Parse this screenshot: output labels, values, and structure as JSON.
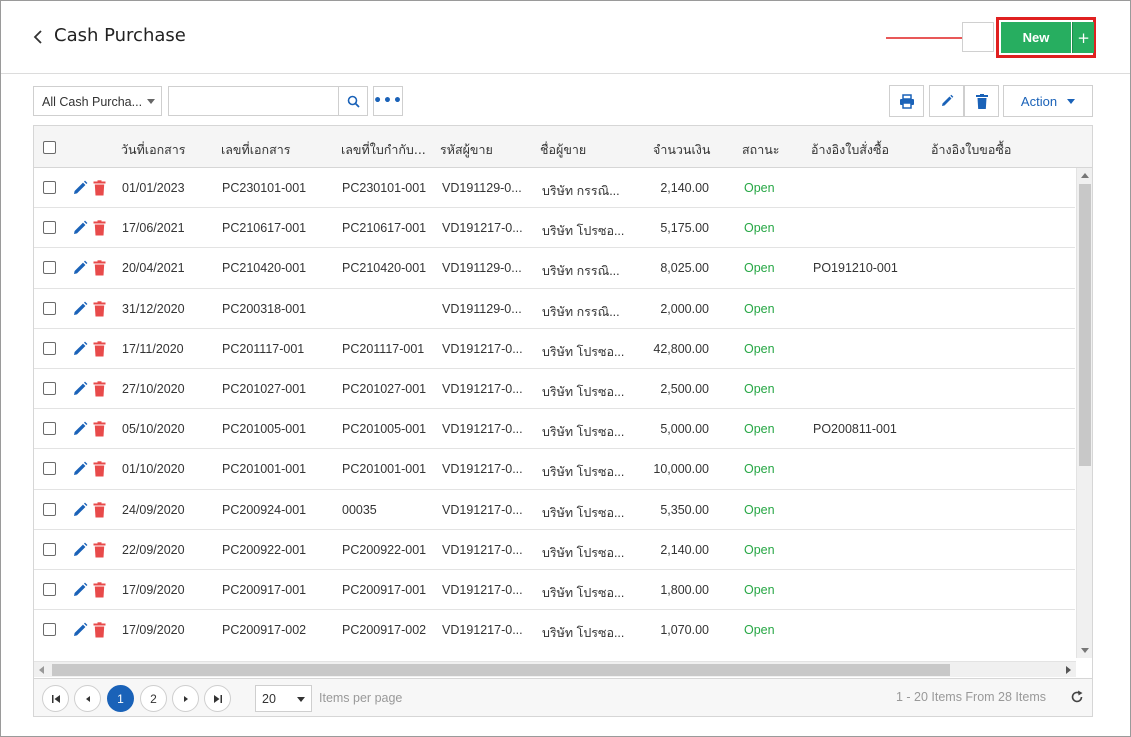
{
  "header": {
    "title": "Cash Purchase",
    "new_label": "New",
    "plus_label": "+"
  },
  "toolbar": {
    "filter_value": "All Cash Purcha...",
    "search_value": "",
    "more_label": "•••",
    "action_label": "Action"
  },
  "table": {
    "columns": [
      "วันที่เอกสาร",
      "เลขที่เอกสาร",
      "เลขที่ใบกำกับ...",
      "รหัสผู้ขาย",
      "ชื่อผู้ขาย",
      "จำนวนเงิน",
      "สถานะ",
      "อ้างอิงใบสั่งซื้อ",
      "อ้างอิงใบขอซื้อ"
    ],
    "rows": [
      {
        "date": "01/01/2023",
        "doc_no": "PC230101-001",
        "tax_inv": "PC230101-001",
        "vendor_code": "VD191129-0...",
        "vendor_name": "บริษัท กรรณิ...",
        "amount": "2,140.00",
        "status": "Open",
        "po_ref": "",
        "pr_ref": ""
      },
      {
        "date": "17/06/2021",
        "doc_no": "PC210617-001",
        "tax_inv": "PC210617-001",
        "vendor_code": "VD191217-0...",
        "vendor_name": "บริษัท โปรซอ...",
        "amount": "5,175.00",
        "status": "Open",
        "po_ref": "",
        "pr_ref": ""
      },
      {
        "date": "20/04/2021",
        "doc_no": "PC210420-001",
        "tax_inv": "PC210420-001",
        "vendor_code": "VD191129-0...",
        "vendor_name": "บริษัท กรรณิ...",
        "amount": "8,025.00",
        "status": "Open",
        "po_ref": "PO191210-001",
        "pr_ref": ""
      },
      {
        "date": "31/12/2020",
        "doc_no": "PC200318-001",
        "tax_inv": "",
        "vendor_code": "VD191129-0...",
        "vendor_name": "บริษัท กรรณิ...",
        "amount": "2,000.00",
        "status": "Open",
        "po_ref": "",
        "pr_ref": ""
      },
      {
        "date": "17/11/2020",
        "doc_no": "PC201117-001",
        "tax_inv": "PC201117-001",
        "vendor_code": "VD191217-0...",
        "vendor_name": "บริษัท โปรซอ...",
        "amount": "42,800.00",
        "status": "Open",
        "po_ref": "",
        "pr_ref": ""
      },
      {
        "date": "27/10/2020",
        "doc_no": "PC201027-001",
        "tax_inv": "PC201027-001",
        "vendor_code": "VD191217-0...",
        "vendor_name": "บริษัท โปรซอ...",
        "amount": "2,500.00",
        "status": "Open",
        "po_ref": "",
        "pr_ref": ""
      },
      {
        "date": "05/10/2020",
        "doc_no": "PC201005-001",
        "tax_inv": "PC201005-001",
        "vendor_code": "VD191217-0...",
        "vendor_name": "บริษัท โปรซอ...",
        "amount": "5,000.00",
        "status": "Open",
        "po_ref": "PO200811-001",
        "pr_ref": ""
      },
      {
        "date": "01/10/2020",
        "doc_no": "PC201001-001",
        "tax_inv": "PC201001-001",
        "vendor_code": "VD191217-0...",
        "vendor_name": "บริษัท โปรซอ...",
        "amount": "10,000.00",
        "status": "Open",
        "po_ref": "",
        "pr_ref": ""
      },
      {
        "date": "24/09/2020",
        "doc_no": "PC200924-001",
        "tax_inv": "00035",
        "vendor_code": "VD191217-0...",
        "vendor_name": "บริษัท โปรซอ...",
        "amount": "5,350.00",
        "status": "Open",
        "po_ref": "",
        "pr_ref": ""
      },
      {
        "date": "22/09/2020",
        "doc_no": "PC200922-001",
        "tax_inv": "PC200922-001",
        "vendor_code": "VD191217-0...",
        "vendor_name": "บริษัท โปรซอ...",
        "amount": "2,140.00",
        "status": "Open",
        "po_ref": "",
        "pr_ref": ""
      },
      {
        "date": "17/09/2020",
        "doc_no": "PC200917-001",
        "tax_inv": "PC200917-001",
        "vendor_code": "VD191217-0...",
        "vendor_name": "บริษัท โปรซอ...",
        "amount": "1,800.00",
        "status": "Open",
        "po_ref": "",
        "pr_ref": ""
      },
      {
        "date": "17/09/2020",
        "doc_no": "PC200917-002",
        "tax_inv": "PC200917-002",
        "vendor_code": "VD191217-0...",
        "vendor_name": "บริษัท โปรซอ...",
        "amount": "1,070.00",
        "status": "Open",
        "po_ref": "",
        "pr_ref": ""
      }
    ]
  },
  "pager": {
    "first_label": "⏮",
    "prev_label": "◀",
    "pages": [
      "1",
      "2"
    ],
    "next_label": "▶",
    "last_label": "⏭",
    "page_size": "20",
    "items_per_page": "Items per page",
    "info": "1 - 20 Items From 28 Items"
  },
  "colors": {
    "accent": "#1a62b8",
    "new_button": "#27ae60",
    "status_open": "#27a745",
    "highlight": "#e02020",
    "delete": "#e84a4a"
  },
  "icons": [
    "back-chevron-icon",
    "search-icon",
    "more-icon",
    "print-icon",
    "edit-icon",
    "trash-icon",
    "refresh-icon"
  ]
}
